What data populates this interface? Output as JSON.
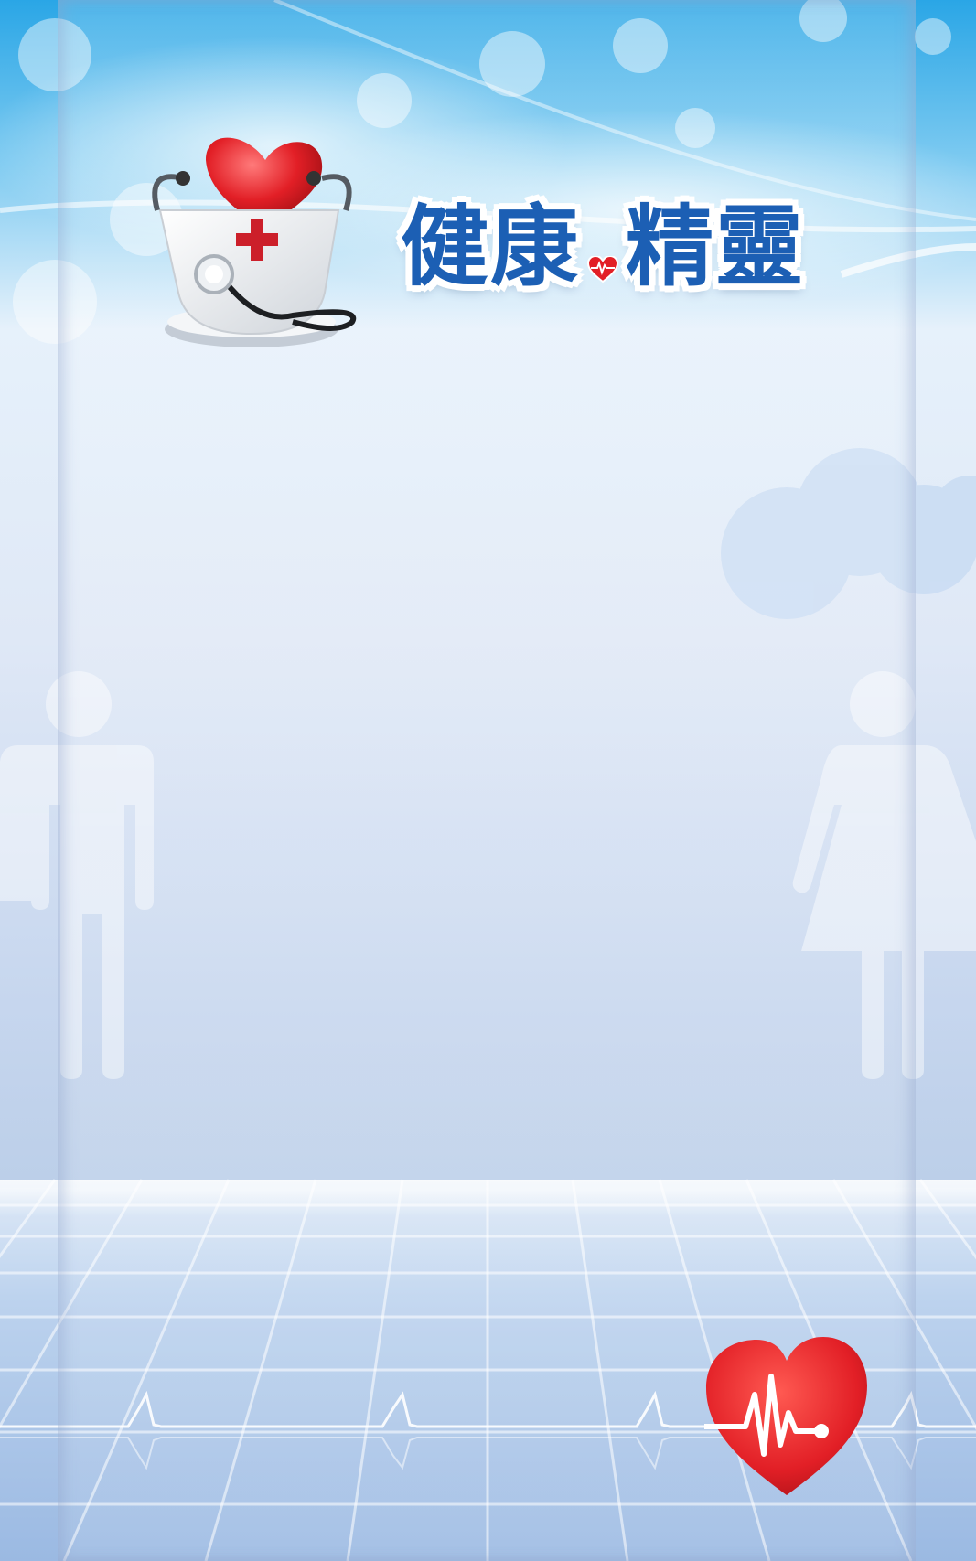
{
  "brand": {
    "title_part1": "健康",
    "title_part2": "精靈"
  },
  "colors": {
    "title_blue": "#1c5fb4",
    "heart_red": "#e21f26",
    "sky_blue": "#2aa6e6",
    "floor_blue": "#8fb0de"
  },
  "icons": [
    "teacup-heart-stethoscope-icon",
    "mini-heart-pulse-icon",
    "male-figure-icon",
    "female-figure-icon",
    "heartbeat-heart-icon"
  ]
}
